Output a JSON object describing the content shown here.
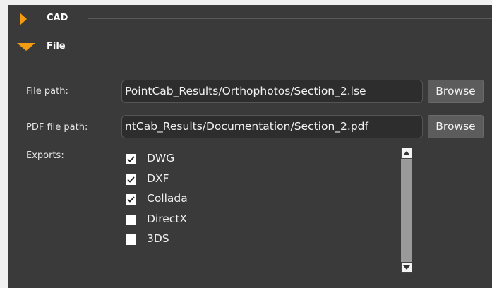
{
  "sections": {
    "cad": {
      "title": "CAD",
      "expanded": false
    },
    "file": {
      "title": "File",
      "expanded": true
    }
  },
  "fields": {
    "file_path": {
      "label": "File path:",
      "value": "PointCab_Results/Orthophotos/Section_2.lse"
    },
    "pdf_file_path": {
      "label": "PDF file path:",
      "value": "ntCab_Results/Documentation/Section_2.pdf"
    },
    "browse_label": "Browse"
  },
  "exports": {
    "label": "Exports:",
    "items": [
      {
        "label": "DWG",
        "checked": true
      },
      {
        "label": "DXF",
        "checked": true
      },
      {
        "label": "Collada",
        "checked": true
      },
      {
        "label": "DirectX",
        "checked": false
      },
      {
        "label": "3DS",
        "checked": false
      }
    ]
  },
  "colors": {
    "accent": "#f39c12",
    "panel": "#3a3a3a"
  }
}
